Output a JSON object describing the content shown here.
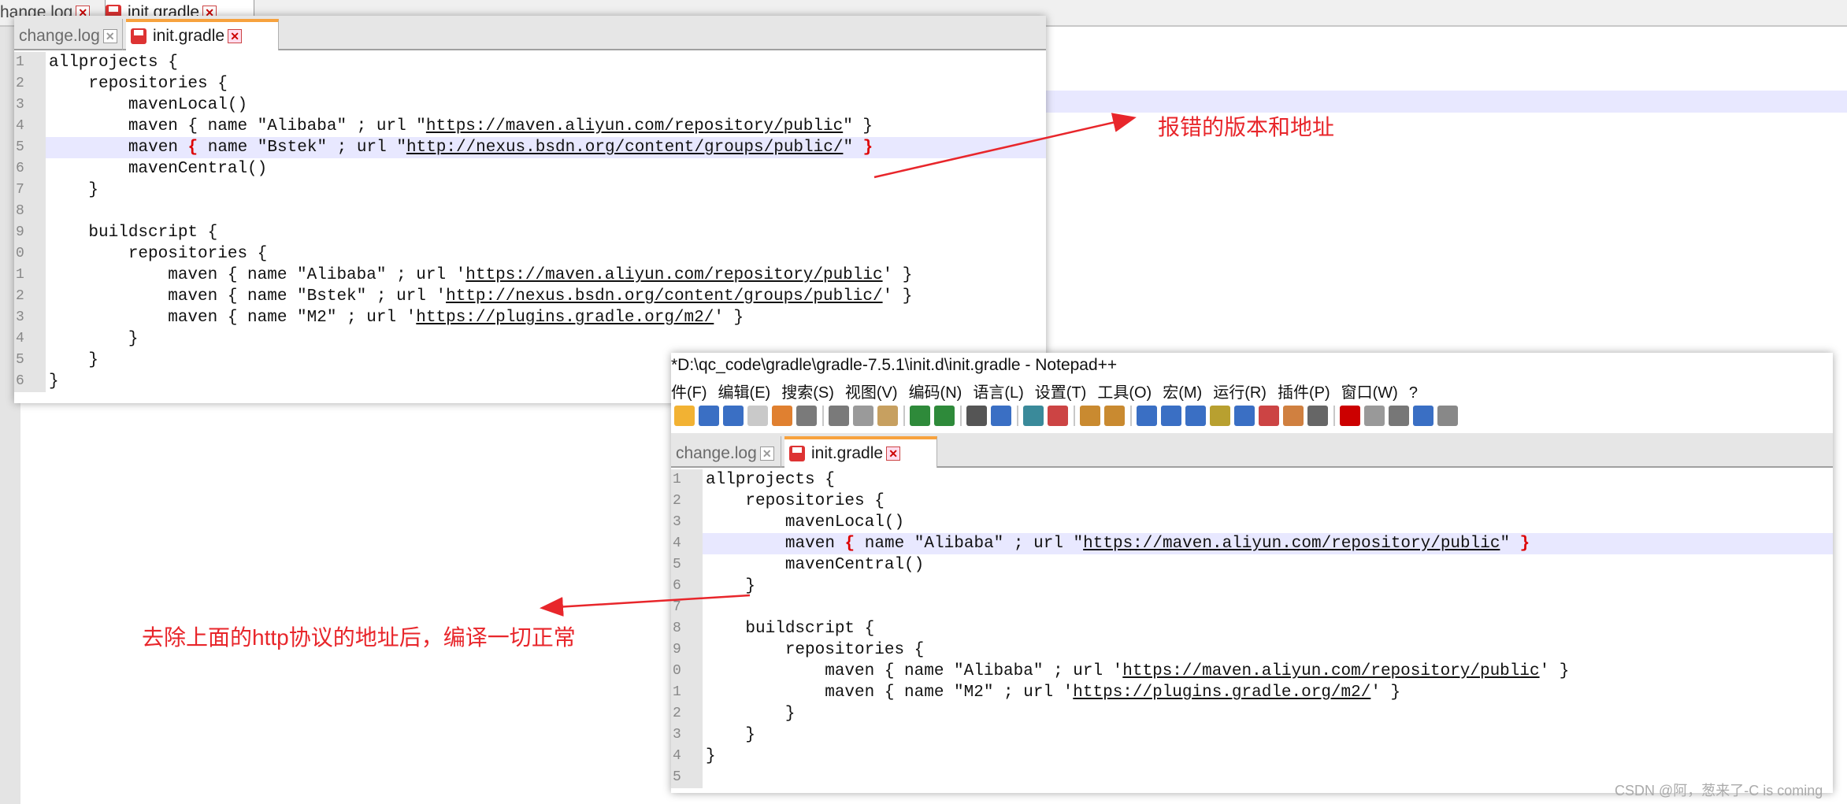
{
  "background": {
    "tabs": [
      "hange log",
      "init gradle"
    ],
    "tab_colors": {
      "active_indicator": "#f7a23e",
      "gutter": "#e4e4e4",
      "highlight": "#e8e8ff"
    }
  },
  "window1": {
    "tabs": [
      "change.log",
      "init.gradle"
    ],
    "active_tab": "init.gradle",
    "line_numbers": [
      "1",
      "2",
      "3",
      "4",
      "5",
      "6",
      "7",
      "8",
      "9",
      "0",
      "1",
      "2",
      "3",
      "4",
      "5",
      "6"
    ],
    "code": [
      "allprojects {",
      "    repositories {",
      "        mavenLocal()",
      "        maven { name \"Alibaba\" ; url \"https://maven.aliyun.com/repository/public\" }",
      "        maven { name \"Bstek\" ; url \"http://nexus.bsdn.org/content/groups/public/\" }",
      "        mavenCentral()",
      "    }",
      "",
      "    buildscript {",
      "        repositories {",
      "            maven { name \"Alibaba\" ; url 'https://maven.aliyun.com/repository/public' }",
      "            maven { name \"Bstek\" ; url 'http://nexus.bsdn.org/content/groups/public/' }",
      "            maven { name \"M2\" ; url 'https://plugins.gradle.org/m2/' }",
      "        }",
      "    }",
      "}"
    ],
    "highlighted_line": 5
  },
  "window2": {
    "title": "*D:\\qc_code\\gradle\\gradle-7.5.1\\init.d\\init.gradle - Notepad++",
    "menu": [
      "件(F)",
      "编辑(E)",
      "搜索(S)",
      "视图(V)",
      "编码(N)",
      "语言(L)",
      "设置(T)",
      "工具(O)",
      "宏(M)",
      "运行(R)",
      "插件(P)",
      "窗口(W)",
      "?"
    ],
    "tabs": [
      "change.log",
      "init.gradle"
    ],
    "active_tab": "init.gradle",
    "line_numbers": [
      "1",
      "2",
      "3",
      "4",
      "5",
      "6",
      "7",
      "8",
      "9",
      "0",
      "1",
      "2",
      "3",
      "4",
      "5"
    ],
    "code": [
      "allprojects {",
      "    repositories {",
      "        mavenLocal()",
      "        maven { name \"Alibaba\" ; url \"https://maven.aliyun.com/repository/public\" }",
      "        mavenCentral()",
      "    }",
      "",
      "    buildscript {",
      "        repositories {",
      "            maven { name \"Alibaba\" ; url 'https://maven.aliyun.com/repository/public' }",
      "            maven { name \"M2\" ; url 'https://plugins.gradle.org/m2/' }",
      "        }",
      "    }",
      "}",
      ""
    ],
    "highlighted_line": 4
  },
  "annotations": {
    "error_note": "报错的版本和地址",
    "fix_note": "去除上面的http协议的地址后，编译一切正常",
    "color": "#e8262b"
  },
  "watermark": "CSDN @阿，葱来了-C is coming"
}
